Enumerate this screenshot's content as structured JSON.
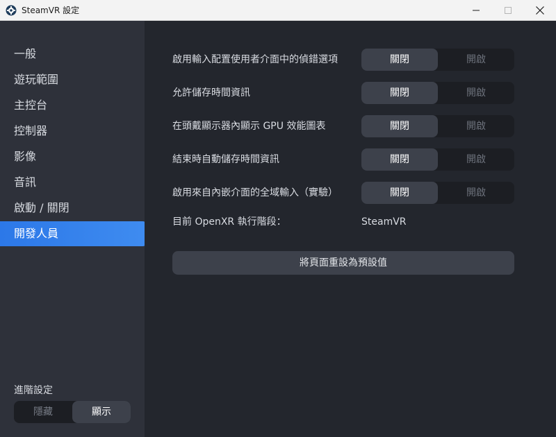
{
  "window": {
    "title": "SteamVR 設定",
    "icon": "steamvr-gear-icon"
  },
  "sidebar": {
    "items": [
      {
        "label": "一般"
      },
      {
        "label": "遊玩範圍"
      },
      {
        "label": "主控台"
      },
      {
        "label": "控制器"
      },
      {
        "label": "影像"
      },
      {
        "label": "音訊"
      },
      {
        "label": "啟動 / 關閉"
      },
      {
        "label": "開發人員",
        "active": true
      }
    ],
    "advanced": {
      "label": "進階設定",
      "hide": "隱藏",
      "show": "顯示",
      "selected": "顯示"
    }
  },
  "settings": [
    {
      "label": "啟用輸入配置使用者介面中的偵錯選項",
      "off": "關閉",
      "on": "開啟",
      "state": "關閉"
    },
    {
      "label": "允許儲存時間資訊",
      "off": "關閉",
      "on": "開啟",
      "state": "關閉"
    },
    {
      "label": "在頭戴顯示器內顯示 GPU 效能圖表",
      "off": "關閉",
      "on": "開啟",
      "state": "關閉"
    },
    {
      "label": "結束時自動儲存時間資訊",
      "off": "關閉",
      "on": "開啟",
      "state": "關閉"
    },
    {
      "label": "啟用來自內嵌介面的全域輸入（實驗）",
      "off": "關閉",
      "on": "開啟",
      "state": "關閉"
    }
  ],
  "runtime": {
    "label": "目前 OpenXR 執行階段：",
    "value": "SteamVR"
  },
  "reset_button": "將頁面重設為預設值",
  "colors": {
    "accent": "#2c78e8",
    "sidebar_bg": "#2e313a",
    "main_bg": "#23262d",
    "toggle_selected": "#3d414b"
  }
}
